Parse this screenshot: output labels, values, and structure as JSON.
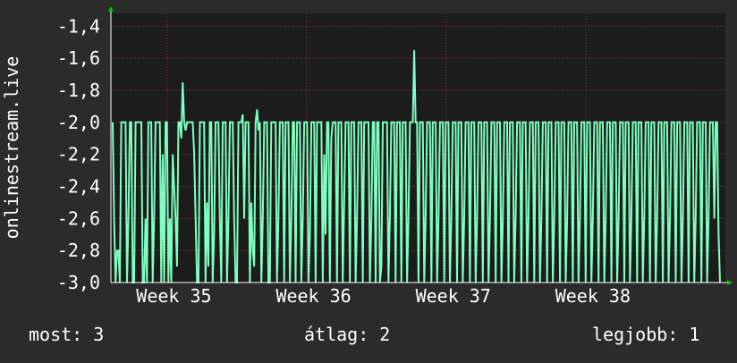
{
  "chart_data": {
    "type": "line",
    "title": "",
    "xlabel": "",
    "ylabel": "onlinestream.live",
    "ylim": [
      -3.0,
      -1.32
    ],
    "y_ticks": [
      "-1,4",
      "-1,6",
      "-1,8",
      "-2,0",
      "-2,2",
      "-2,4",
      "-2,6",
      "-2,8",
      "-3,0"
    ],
    "y_tick_values": [
      -1.4,
      -1.6,
      -1.8,
      -2.0,
      -2.2,
      -2.4,
      -2.6,
      -2.8,
      -3.0
    ],
    "x_ticks": [
      "Week 35",
      "Week 36",
      "Week 37",
      "Week 38"
    ],
    "x_range_weeks": [
      34.6,
      39.0
    ],
    "x_tick_values": [
      35,
      36,
      37,
      38
    ],
    "grid": true,
    "legend": "none",
    "line_color": "#7fffbf",
    "series": [
      {
        "values": [
          -2.0,
          -2.6,
          -3.0,
          -2.8,
          -2.8,
          -3.0,
          -2.0,
          -2.0,
          -2.0,
          -2.0,
          -3.0,
          -2.6,
          -2.0,
          -2.0,
          -3.0,
          -3.0,
          -2.0,
          -2.0,
          -2.0,
          -2.0,
          -2.0,
          -3.0,
          -3.0,
          -2.6,
          -3.0,
          -2.0,
          -2.0,
          -2.0,
          -3.0,
          -2.6,
          -2.0,
          -2.0,
          -2.0,
          -2.0,
          -3.0,
          -2.2,
          -3.0,
          -2.0,
          -2.0,
          -3.0,
          -2.6,
          -3.0,
          -2.2,
          -2.4,
          -2.6,
          -2.9,
          -2.0,
          -2.0,
          -2.1,
          -1.75,
          -2.0,
          -2.05,
          -2.0,
          -2.0,
          -2.0,
          -2.0,
          -2.0,
          -2.2,
          -2.6,
          -3.0,
          -3.0,
          -2.0,
          -2.0,
          -2.0,
          -2.0,
          -3.0,
          -2.5,
          -2.9,
          -2.0,
          -2.0,
          -3.0,
          -2.7,
          -2.0,
          -2.0,
          -2.0,
          -2.6,
          -3.0,
          -2.0,
          -2.0,
          -2.0,
          -3.0,
          -2.6,
          -2.0,
          -2.0,
          -2.0,
          -2.6,
          -3.0,
          -3.0,
          -2.0,
          -2.0,
          -2.0,
          -1.95,
          -2.6,
          -2.0,
          -2.0,
          -2.0,
          -3.0,
          -2.5,
          -2.8,
          -2.9,
          -2.0,
          -1.92,
          -2.05,
          -2.0,
          -3.0,
          -2.6,
          -2.0,
          -2.0,
          -2.0,
          -3.0,
          -3.0,
          -2.0,
          -2.0,
          -2.0,
          -2.0,
          -3.0,
          -2.6,
          -2.0,
          -2.0,
          -2.0,
          -3.0,
          -2.0,
          -2.0,
          -2.0,
          -3.0,
          -2.6,
          -2.0,
          -2.0,
          -3.0,
          -2.0,
          -2.0,
          -2.0,
          -3.0,
          -2.6,
          -2.0,
          -2.0,
          -2.0,
          -3.0,
          -2.7,
          -2.0,
          -2.0,
          -2.0,
          -3.0,
          -2.0,
          -2.0,
          -2.0,
          -2.0,
          -3.0,
          -2.2,
          -2.7,
          -2.0,
          -2.0,
          -3.0,
          -2.1,
          -2.0,
          -2.0,
          -2.0,
          -3.0,
          -2.0,
          -2.0,
          -2.0,
          -3.0,
          -2.5,
          -2.0,
          -2.0,
          -2.0,
          -3.0,
          -2.0,
          -2.0,
          -2.0,
          -3.0,
          -2.6,
          -2.0,
          -2.0,
          -2.0,
          -3.0,
          -2.0,
          -2.0,
          -2.0,
          -2.0,
          -3.0,
          -2.6,
          -2.0,
          -2.0,
          -3.0,
          -2.0,
          -2.0,
          -3.0,
          -2.9,
          -2.0,
          -2.0,
          -2.0,
          -2.0,
          -3.0,
          -2.6,
          -2.0,
          -2.0,
          -2.0,
          -3.0,
          -2.0,
          -2.0,
          -2.0,
          -3.0,
          -2.0,
          -2.0,
          -2.0,
          -3.0,
          -2.6,
          -2.0,
          -2.0,
          -2.0,
          -1.55,
          -2.0,
          -2.0,
          -3.0,
          -2.0,
          -2.0,
          -2.0,
          -3.0,
          -2.6,
          -2.0,
          -2.0,
          -2.0,
          -3.0,
          -2.0,
          -2.0,
          -2.0,
          -3.0,
          -2.6,
          -2.0,
          -2.0,
          -2.0,
          -3.0,
          -2.0,
          -2.0,
          -2.0,
          -3.0,
          -2.6,
          -2.0,
          -2.0,
          -2.0,
          -3.0,
          -2.0,
          -2.0,
          -2.0,
          -3.0,
          -2.6,
          -2.0,
          -2.0,
          -2.0,
          -3.0,
          -2.0,
          -2.0,
          -2.0,
          -3.0,
          -2.6,
          -2.0,
          -2.0,
          -2.0,
          -3.0,
          -2.0,
          -2.0,
          -2.0,
          -3.0,
          -2.6,
          -2.0,
          -2.0,
          -2.0,
          -3.0,
          -2.0,
          -2.0,
          -2.0,
          -3.0,
          -2.6,
          -2.0,
          -2.0,
          -2.0,
          -3.0,
          -2.0,
          -2.0,
          -2.0,
          -3.0,
          -2.6,
          -2.0,
          -2.0,
          -2.0,
          -3.0,
          -2.0,
          -2.0,
          -2.0,
          -3.0,
          -2.6,
          -2.0,
          -2.0,
          -2.0,
          -3.0,
          -2.0,
          -2.0,
          -2.0,
          -3.0,
          -2.6,
          -2.0,
          -2.0,
          -2.0,
          -3.0,
          -2.0,
          -2.0,
          -2.0,
          -3.0,
          -2.6,
          -2.0,
          -2.0,
          -2.0,
          -3.0,
          -2.0,
          -2.0,
          -2.0,
          -3.0,
          -2.6,
          -2.0,
          -2.0,
          -2.0,
          -3.0,
          -2.0,
          -2.0,
          -2.0,
          -3.0,
          -2.6,
          -2.0,
          -2.0,
          -2.0,
          -3.0,
          -2.0,
          -2.0,
          -2.0,
          -3.0,
          -2.6,
          -2.0,
          -2.0,
          -2.0,
          -3.0,
          -2.0,
          -2.0,
          -2.0,
          -3.0,
          -2.6,
          -2.0,
          -2.0,
          -2.0,
          -3.0,
          -2.0,
          -2.0,
          -2.0,
          -3.0,
          -2.6,
          -2.0,
          -2.0,
          -2.0,
          -3.0,
          -2.0,
          -2.0,
          -2.0,
          -3.0,
          -2.6,
          -2.0,
          -2.0,
          -2.0,
          -3.0,
          -2.0,
          -2.0,
          -2.0,
          -3.0,
          -2.6,
          -2.0,
          -2.0,
          -2.0,
          -3.0,
          -2.0,
          -2.0,
          -2.0,
          -3.0,
          -2.6,
          -2.0,
          -2.0,
          -2.0,
          -3.0,
          -2.0,
          -2.0,
          -2.0,
          -3.0,
          -2.6,
          -2.0,
          -2.0,
          -2.0,
          -3.0,
          -2.0,
          -2.0,
          -2.0,
          -3.0,
          -2.6,
          -2.0,
          -2.0,
          -2.0,
          -3.0,
          -2.0,
          -2.0,
          -2.0,
          -3.0,
          -2.6,
          -2.0,
          -2.0,
          -2.0,
          -3.0,
          -2.0,
          -2.0,
          -2.0,
          -3.0,
          -2.6,
          -2.0,
          -2.0,
          -2.0,
          -2.6,
          -2.0,
          -2.0,
          -2.7,
          -3.0
        ]
      }
    ]
  },
  "stats": {
    "now": "most: 3",
    "avg": "átlag: 2",
    "best": "legjobb: 1"
  }
}
